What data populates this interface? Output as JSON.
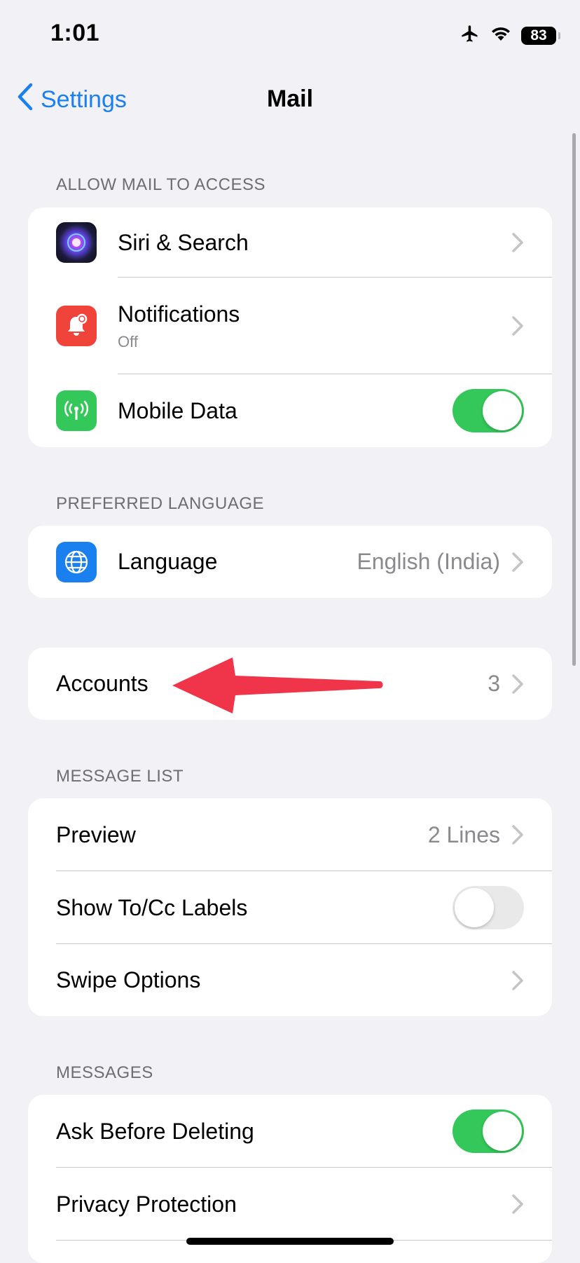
{
  "status_bar": {
    "time": "1:01",
    "battery": "83",
    "icons": [
      "airplane-icon",
      "wifi-icon",
      "battery-icon"
    ]
  },
  "nav": {
    "back_label": "Settings",
    "title": "Mail"
  },
  "sections": {
    "allow_access": {
      "header": "ALLOW MAIL TO ACCESS",
      "siri": {
        "label": "Siri & Search",
        "icon": "siri-icon"
      },
      "notifications": {
        "label": "Notifications",
        "sub": "Off",
        "icon": "bell-icon",
        "icon_color": "#f0443a"
      },
      "mobile_data": {
        "label": "Mobile Data",
        "icon": "antenna-icon",
        "icon_color": "#34c759",
        "toggle": "on"
      }
    },
    "language": {
      "header": "PREFERRED LANGUAGE",
      "row": {
        "label": "Language",
        "value": "English (India)",
        "icon": "globe-icon",
        "icon_color": "#1a7fef"
      }
    },
    "accounts": {
      "row": {
        "label": "Accounts",
        "value": "3"
      }
    },
    "message_list": {
      "header": "MESSAGE LIST",
      "preview": {
        "label": "Preview",
        "value": "2 Lines"
      },
      "to_cc": {
        "label": "Show To/Cc Labels",
        "toggle": "off"
      },
      "swipe": {
        "label": "Swipe Options"
      }
    },
    "messages": {
      "header": "MESSAGES",
      "ask_delete": {
        "label": "Ask Before Deleting",
        "toggle": "on"
      },
      "privacy": {
        "label": "Privacy Protection"
      }
    }
  },
  "colors": {
    "accent": "#1a7fef",
    "toggle_on": "#34c759",
    "annotation_arrow": "#f0344a",
    "background": "#f2f1f6"
  }
}
